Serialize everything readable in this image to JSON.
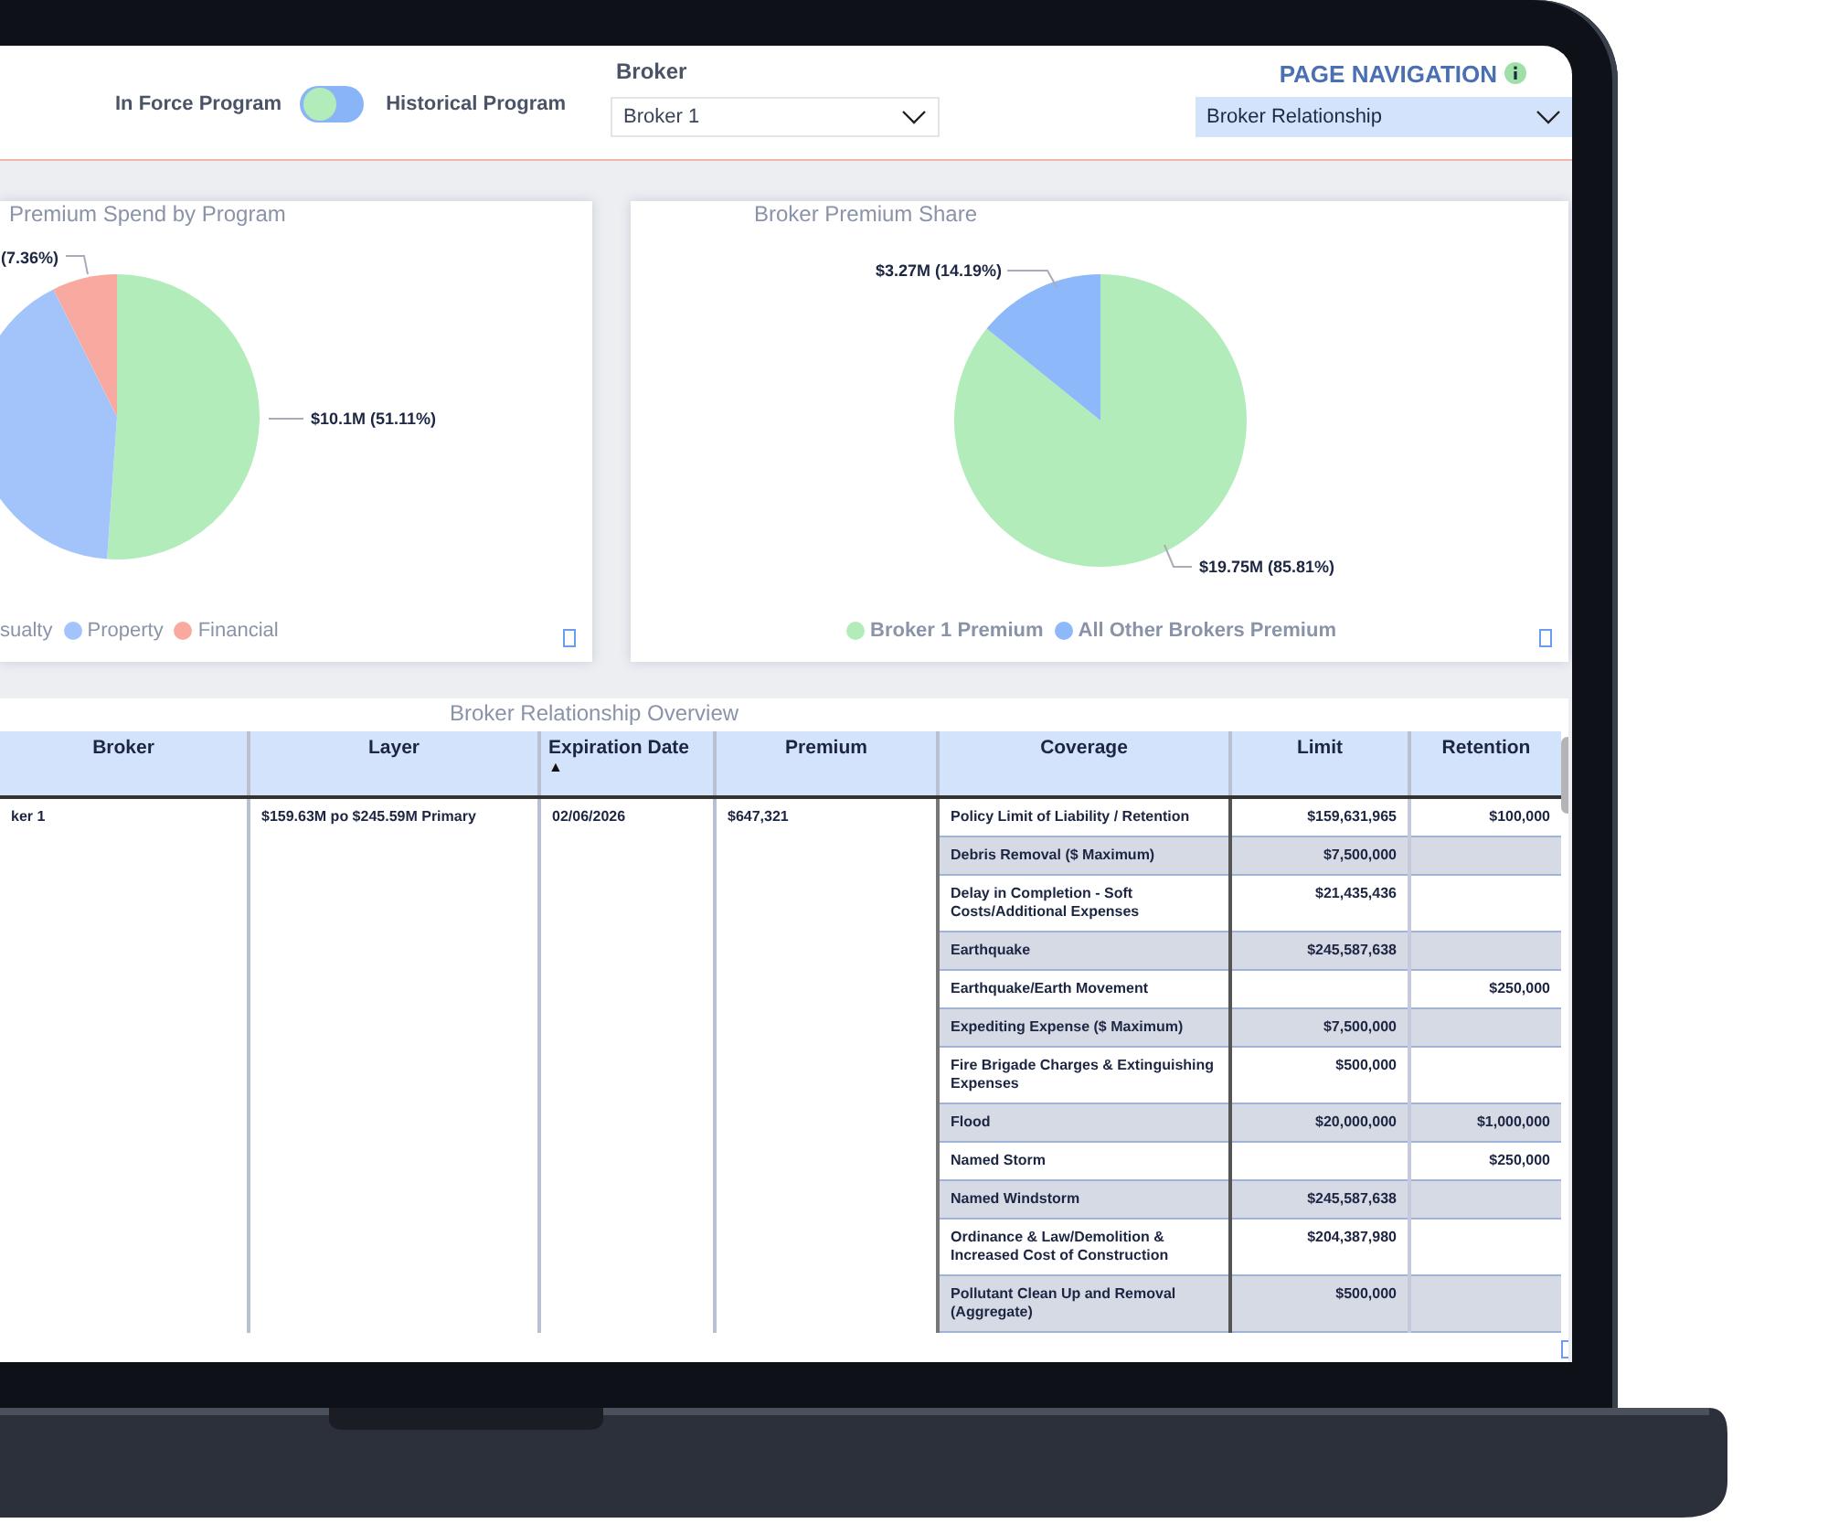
{
  "filters": {
    "toggle": {
      "left_label": "In Force Program",
      "right_label": "Historical Program",
      "on": false
    },
    "broker": {
      "label": "Broker",
      "value": "Broker 1"
    }
  },
  "page_navigation": {
    "title": "PAGE NAVIGATION",
    "value": "Broker Relationship"
  },
  "charts": [
    {
      "chart_data": {
        "type": "pie",
        "title": "Premium Spend by Program",
        "categories": [
          "sualty",
          "Property",
          "Financial"
        ],
        "values": [
          51.11,
          41.53,
          7.36
        ],
        "colors": [
          "#b3ecbb",
          "#a3c4fa",
          "#f9aaa0"
        ],
        "value_labels": [
          "$10.1M (51.11%)",
          null,
          "(7.36%)"
        ]
      }
    },
    {
      "chart_data": {
        "type": "pie",
        "title": "Broker Premium Share",
        "categories": [
          "Broker 1 Premium",
          "All Other Brokers Premium"
        ],
        "values": [
          85.81,
          14.19
        ],
        "colors": [
          "#b3ecbb",
          "#8db8fa"
        ],
        "value_labels": [
          "$19.75M (85.81%)",
          "$3.27M (14.19%)"
        ]
      }
    }
  ],
  "table": {
    "title": "Broker Relationship Overview",
    "columns": [
      {
        "label": "Broker"
      },
      {
        "label": "Layer"
      },
      {
        "label": "Expiration Date",
        "sort_arrow": "▲"
      },
      {
        "label": "Premium"
      },
      {
        "label": "Coverage"
      },
      {
        "label": "Limit"
      },
      {
        "label": "Retention"
      }
    ],
    "program": {
      "broker": "ker 1",
      "layer": "$159.63M po $245.59M Primary",
      "expiration_date": "02/06/2026",
      "premium": "$647,321"
    },
    "coverages": [
      {
        "coverage": "Policy Limit of Liability / Retention",
        "limit": "$159,631,965",
        "retention": "$100,000"
      },
      {
        "coverage": "Debris Removal ($ Maximum)",
        "limit": "$7,500,000"
      },
      {
        "coverage": "Delay in Completion - Soft Costs/Additional Expenses",
        "limit": "$21,435,436"
      },
      {
        "coverage": "Earthquake",
        "limit": "$245,587,638"
      },
      {
        "coverage": "Earthquake/Earth Movement",
        "retention": "$250,000"
      },
      {
        "coverage": "Expediting Expense ($ Maximum)",
        "limit": "$7,500,000"
      },
      {
        "coverage": "Fire Brigade Charges & Extinguishing Expenses",
        "limit": "$500,000"
      },
      {
        "coverage": "Flood",
        "limit": "$20,000,000",
        "retention": "$1,000,000"
      },
      {
        "coverage": "Named Storm",
        "retention": "$250,000"
      },
      {
        "coverage": "Named Windstorm",
        "limit": "$245,587,638"
      },
      {
        "coverage": "Ordinance & Law/Demolition & Increased Cost of Construction",
        "limit": "$204,387,980"
      },
      {
        "coverage": "Pollutant Clean Up and Removal (Aggregate)",
        "limit": "$500,000"
      }
    ]
  }
}
